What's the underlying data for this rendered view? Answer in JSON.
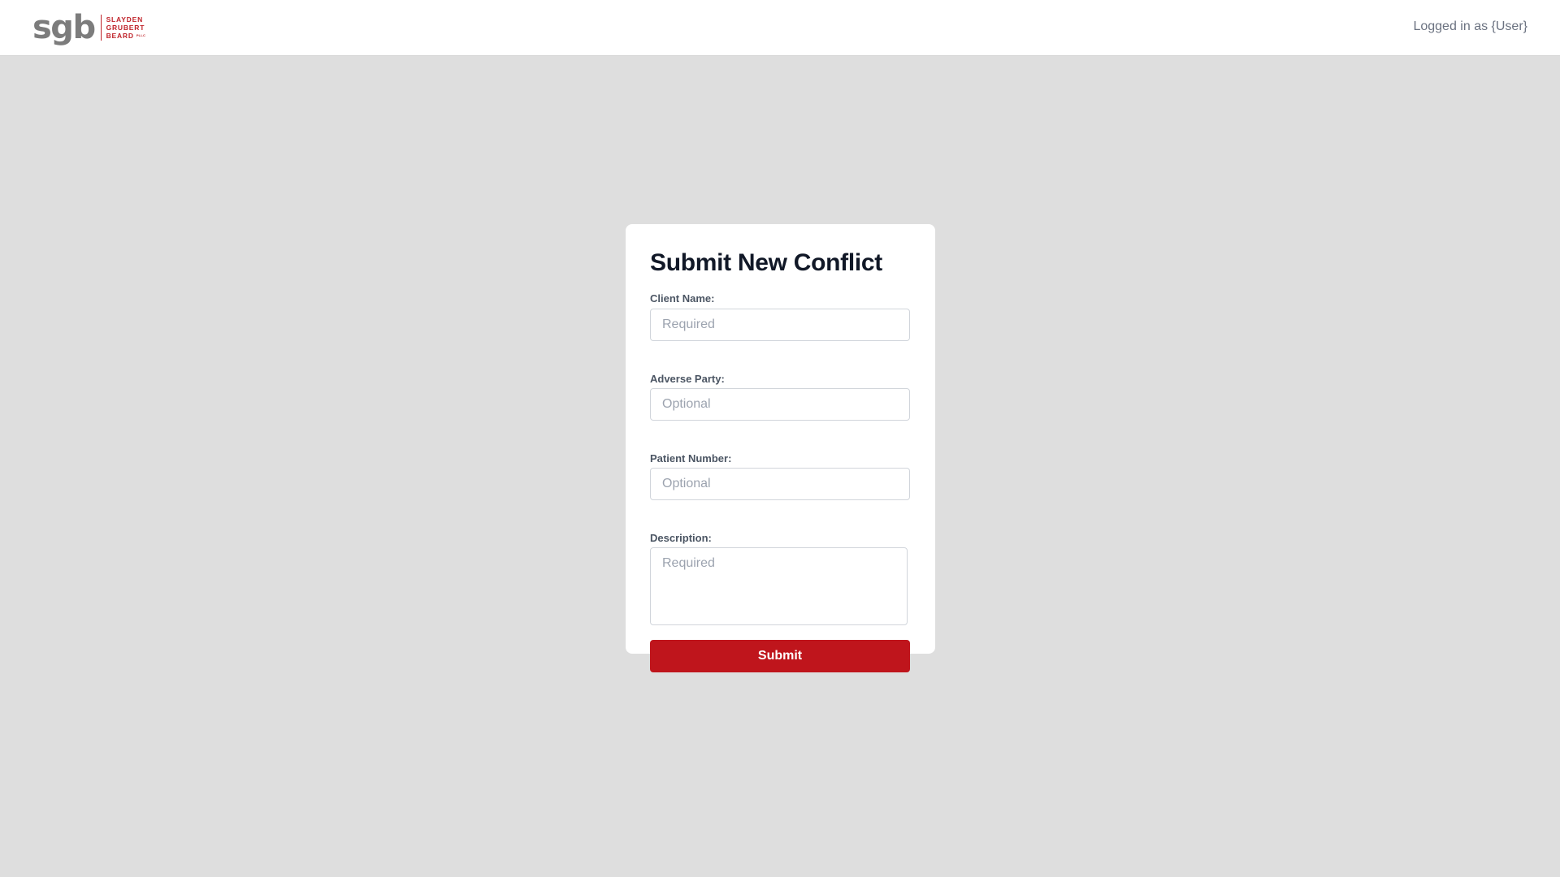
{
  "header": {
    "logo": {
      "mark": "sgb",
      "lines": [
        "SLAYDEN",
        "GRUBERT",
        "BEARD"
      ],
      "suffix": "PLLC",
      "accent_color": "#c0242b"
    },
    "user_label": "Logged in as {User}"
  },
  "form": {
    "title": "Submit New Conflict",
    "fields": [
      {
        "label": "Client Name:",
        "placeholder": "Required",
        "value": ""
      },
      {
        "label": "Adverse Party:",
        "placeholder": "Optional",
        "value": ""
      },
      {
        "label": "Patient Number:",
        "placeholder": "Optional",
        "value": ""
      },
      {
        "label": "Description:",
        "placeholder": "Required",
        "value": ""
      }
    ],
    "submit_label": "Submit",
    "submit_color": "#bf151c"
  }
}
